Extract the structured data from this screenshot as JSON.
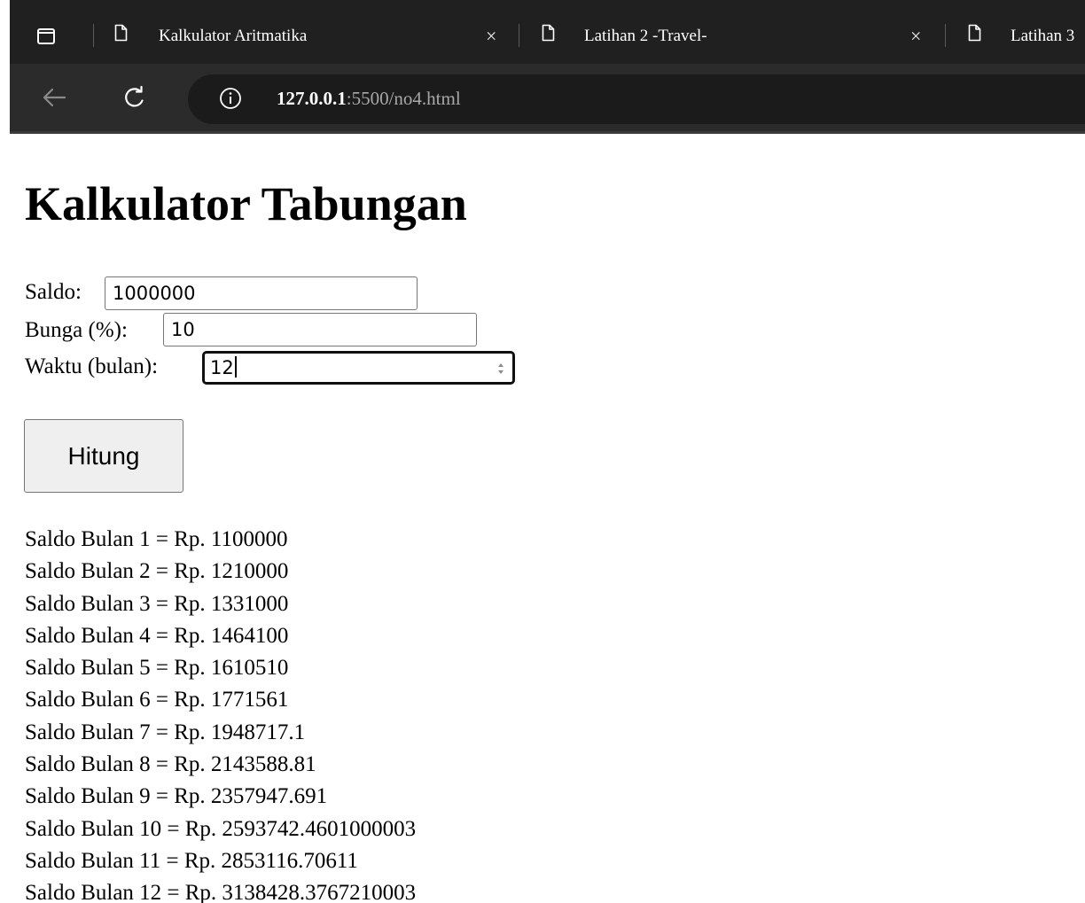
{
  "browser": {
    "tabs": [
      {
        "title": "Kalkulator Aritmatika",
        "close": "×"
      },
      {
        "title": "Latihan 2 -Travel-",
        "close": "×"
      },
      {
        "title": "Latihan 3"
      }
    ],
    "address": {
      "host": "127.0.0.1",
      "rest": ":5500/no4.html"
    },
    "icons": [
      "tab-actions-icon",
      "page-icon",
      "close-icon",
      "back-icon",
      "refresh-icon",
      "info-icon"
    ]
  },
  "page": {
    "title": "Kalkulator Tabungan",
    "form": {
      "saldo_label": "Saldo:",
      "saldo_value": "1000000",
      "bunga_label": "Bunga (%):",
      "bunga_value": "10",
      "waktu_label": "Waktu (bulan):",
      "waktu_value": "12"
    },
    "button_label": "Hitung",
    "results": [
      "Saldo Bulan 1 = Rp. 1100000",
      "Saldo Bulan 2 = Rp. 1210000",
      "Saldo Bulan 3 = Rp. 1331000",
      "Saldo Bulan 4 = Rp. 1464100",
      "Saldo Bulan 5 = Rp. 1610510",
      "Saldo Bulan 6 = Rp. 1771561",
      "Saldo Bulan 7 = Rp. 1948717.1",
      "Saldo Bulan 8 = Rp. 2143588.81",
      "Saldo Bulan 9 = Rp. 2357947.691",
      "Saldo Bulan 10 = Rp. 2593742.4601000003",
      "Saldo Bulan 11 = Rp. 2853116.70611",
      "Saldo Bulan 12 = Rp. 3138428.3767210003"
    ]
  },
  "colors": {
    "tabstrip": "#202020",
    "toolbar": "#2b2b2b",
    "address_bar": "#1b1b1b",
    "url_host": "#ffffff",
    "url_rest": "#a8a8a8",
    "button_bg": "#efefef"
  }
}
